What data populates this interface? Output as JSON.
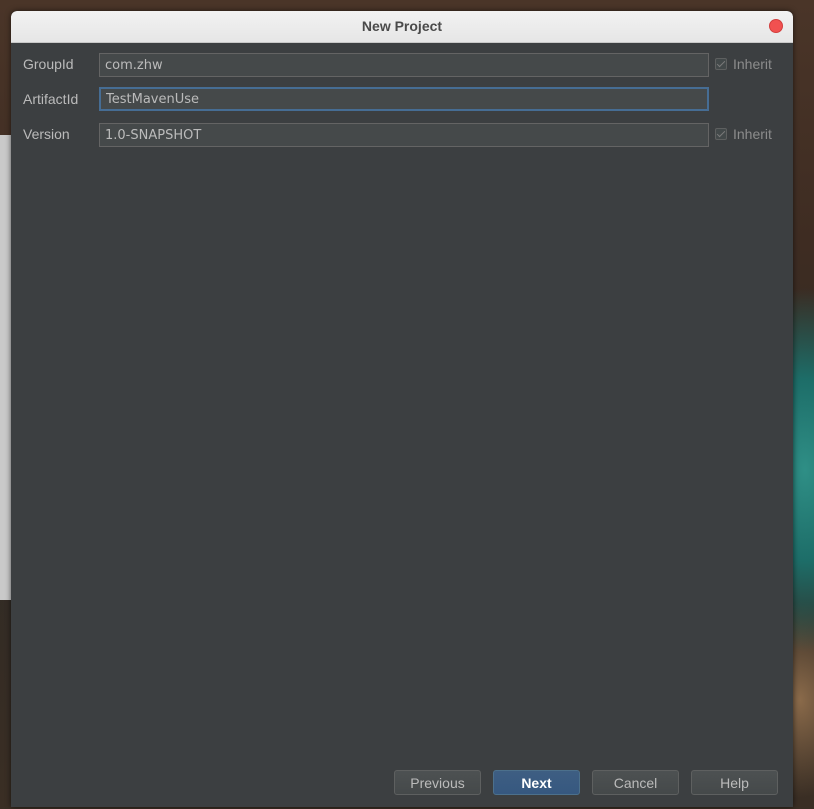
{
  "dialog": {
    "title": "New Project"
  },
  "form": {
    "group_id": {
      "label": "GroupId",
      "value": "com.zhw",
      "inherit_label": "Inherit",
      "inherit_checked": true
    },
    "artifact_id": {
      "label": "ArtifactId",
      "value": "TestMavenUse"
    },
    "version": {
      "label": "Version",
      "value": "1.0-SNAPSHOT",
      "inherit_label": "Inherit",
      "inherit_checked": true
    }
  },
  "buttons": {
    "previous": "Previous",
    "next": "Next",
    "cancel": "Cancel",
    "help": "Help"
  },
  "colors": {
    "panel_bg": "#3c3f41",
    "accent": "#365880",
    "close": "#f15150"
  }
}
